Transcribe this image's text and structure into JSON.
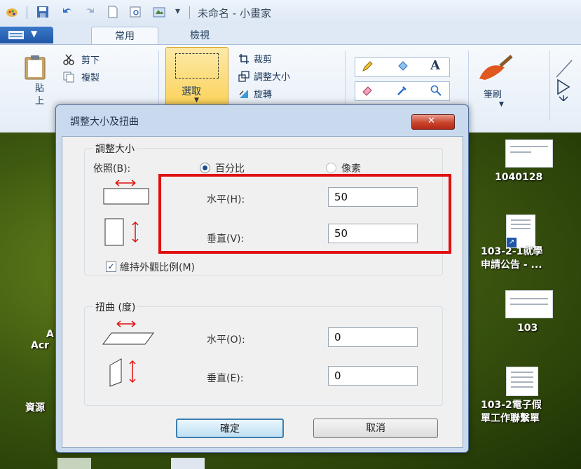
{
  "window": {
    "title": "未命名 - 小畫家",
    "dropdown_glyph": "▾"
  },
  "tabs": [
    {
      "label": "常用"
    },
    {
      "label": "檢視"
    }
  ],
  "ribbon": {
    "paste_label": "貼\n上",
    "cut_label": "剪下",
    "copy_label": "複製",
    "select_label": "選取",
    "crop_label": "裁剪",
    "resize_label": "調整大小",
    "rotate_label": "旋轉",
    "brush_label": "筆刷",
    "text_tool_glyph": "A"
  },
  "desktop": {
    "icons": [
      {
        "label": "1040128"
      },
      {
        "label": "103-2-1就學\n申請公告 - ..."
      },
      {
        "label": "103"
      },
      {
        "label": "103-2電子假\n單工作聯繫單"
      }
    ],
    "left_labels": [
      "A",
      "Acr",
      "資源"
    ]
  },
  "dialog": {
    "title": "調整大小及扭曲",
    "close_glyph": "✕",
    "resize_group": {
      "label": "調整大小",
      "by_label": "依照(B):",
      "percent_label": "百分比",
      "pixels_label": "像素",
      "horizontal_label": "水平(H):",
      "horizontal_value": "50",
      "vertical_label": "垂直(V):",
      "vertical_value": "50",
      "maintain_label": "維持外觀比例(M)",
      "maintain_checked": true,
      "selected_mode": "percent"
    },
    "skew_group": {
      "label": "扭曲 (度)",
      "horizontal_label": "水平(O):",
      "horizontal_value": "0",
      "vertical_label": "垂直(E):",
      "vertical_value": "0"
    },
    "ok_label": "確定",
    "cancel_label": "取消"
  },
  "colors": {
    "highlight": "#e01010",
    "accent": "#1f56a5"
  }
}
